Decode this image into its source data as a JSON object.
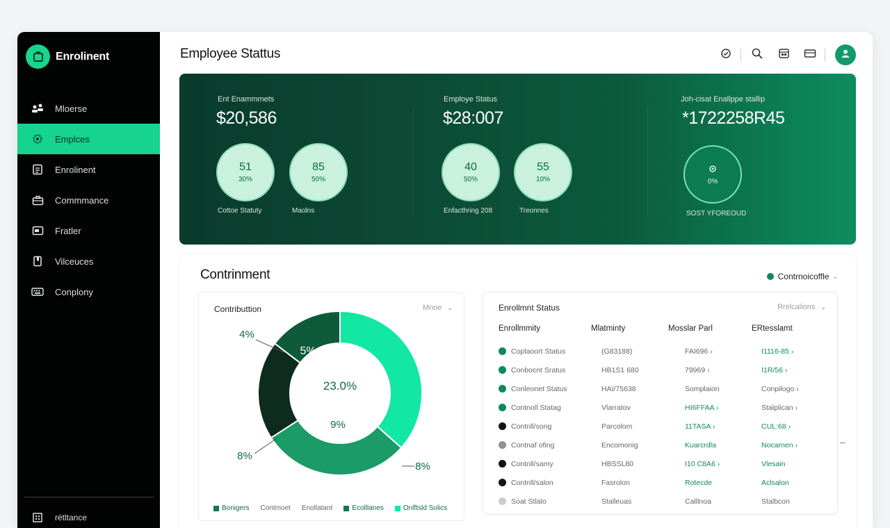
{
  "app": {
    "name": "Enrolinent"
  },
  "sidebar": {
    "items": [
      {
        "label": "Mloerse",
        "icon": "people-icon",
        "active": false
      },
      {
        "label": "Emplces",
        "icon": "gear-icon",
        "active": true
      },
      {
        "label": "Enrolinent",
        "icon": "document-icon",
        "active": false
      },
      {
        "label": "Commmance",
        "icon": "briefcase-icon",
        "active": false
      },
      {
        "label": "Fratler",
        "icon": "card-icon",
        "active": false
      },
      {
        "label": "Vilceuces",
        "icon": "bookmark-icon",
        "active": false
      },
      {
        "label": "Conplony",
        "icon": "keyboard-icon",
        "active": false
      }
    ],
    "footer": {
      "label": "rétltance",
      "icon": "building-icon"
    }
  },
  "header": {
    "title": "Employee Stattus",
    "tools": [
      "refresh-icon",
      "search-icon",
      "calendar-icon",
      "folder-icon"
    ],
    "avatar_icon": "user-avatar-icon"
  },
  "hero": {
    "stats": [
      {
        "label": "Ent Enammmets",
        "value": "$20,586",
        "bubbles": [
          {
            "big": "51",
            "small": "30%",
            "caption": "Cottoe Statuty"
          },
          {
            "big": "85",
            "small": "50%",
            "caption": "Maolns"
          }
        ]
      },
      {
        "label": "Employe Status",
        "value": "$28:007",
        "bubbles": [
          {
            "big": "40",
            "small": "50%",
            "caption": "Enfacthring 208"
          },
          {
            "big": "55",
            "small": "10%",
            "caption": "Treonnes"
          }
        ]
      },
      {
        "label": "Joh-cisat Enallppe stallip",
        "value": "*1722258R45",
        "ring": {
          "small": "0%",
          "caption": "SOST YFOREOUD"
        }
      }
    ]
  },
  "panel": {
    "title": "Contrinment",
    "filter_label": "Contrnoicoffle",
    "chart_title": "Contributtion",
    "chart_more": "Mnoe",
    "table_title": "Enrollmnt Status",
    "table_more": "Rrelcalions",
    "columns": [
      "Enrollmmity",
      "Mlatminty",
      "Mosslar Parl",
      "ERtesslamt"
    ]
  },
  "chart_data": {
    "type": "pie",
    "title": "Contributtion",
    "slices": [
      {
        "label": "8%",
        "value": 30,
        "color": "#12e7a4"
      },
      {
        "label": "8%",
        "value": 24,
        "color": "#1a9b67"
      },
      {
        "label": "",
        "value": 16,
        "color": "#0d2b1f"
      },
      {
        "label": "5%",
        "value": 12,
        "color": "#0f5a3a"
      }
    ],
    "annotations": [
      "4%",
      "5%",
      "23.0%",
      "9%",
      "8%",
      "8%"
    ],
    "legend": [
      {
        "label": "Bonigers",
        "color": "#0f7a4f"
      },
      {
        "label": "Contmoet",
        "color": ""
      },
      {
        "label": "Enollatant",
        "color": ""
      },
      {
        "label": "Ecolllanes",
        "color": "#0f7a4f"
      },
      {
        "label": "Onlftsld Solics",
        "color": "#12e7a4"
      }
    ]
  },
  "table": {
    "rows": [
      {
        "dot": "#0c8a5d",
        "c1": "Coplaoort Status",
        "c2": "(G83188)",
        "c3": "FAI696 ›",
        "c4": "I1116-85 ›",
        "c3_green": false,
        "c4_green": true
      },
      {
        "dot": "#0c8a5d",
        "c1": "Conbocnt Sratus",
        "c2": "HB1S1 680",
        "c3": "79969 ›",
        "c4": "I1R/56 ›",
        "c3_green": false,
        "c4_green": true
      },
      {
        "dot": "#0c8a5d",
        "c1": "Conleonet Status",
        "c2": "HAI/75638",
        "c3": "Somplaion",
        "c4": "Conpilogo ›",
        "c3_green": false,
        "c4_green": false
      },
      {
        "dot": "#0c8a5d",
        "c1": "Contnoll Statag",
        "c2": "Vlarratov",
        "c3": "HI6FFAA ›",
        "c4": "Stalplican ›",
        "c3_green": true,
        "c4_green": false
      },
      {
        "dot": "#101512",
        "c1": "Contnll/song",
        "c2": "Parcolom",
        "c3": "11TASA ›",
        "c4": "CUL:68 ›",
        "c3_green": true,
        "c4_green": true
      },
      {
        "dot": "#8c928f",
        "c1": "Contnaf ofing",
        "c2": "Encomonig",
        "c3": "Kuarcrdla",
        "c4": "Nocarnen ›",
        "c3_green": true,
        "c4_green": true
      },
      {
        "dot": "#101512",
        "c1": "Contnll/samy",
        "c2": "HBSSL80",
        "c3": "I10 C8A6 ›",
        "c4": "Vlesain",
        "c3_green": true,
        "c4_green": true
      },
      {
        "dot": "#101512",
        "c1": "Contnll/salon",
        "c2": "Fasrolon",
        "c3": "Rotecde",
        "c4": "Aclsalon",
        "c3_green": true,
        "c4_green": true
      },
      {
        "dot": "#c9cecb",
        "c1": "Soat Stlalo",
        "c2": "Stalleuas",
        "c3": "Calllnoa",
        "c4": "Stalbcon",
        "c3_green": false,
        "c4_green": false
      }
    ]
  },
  "colors": {
    "accent": "#16d390",
    "hero_dark": "#0a3b2c",
    "brand_green": "#0c8a5d"
  }
}
